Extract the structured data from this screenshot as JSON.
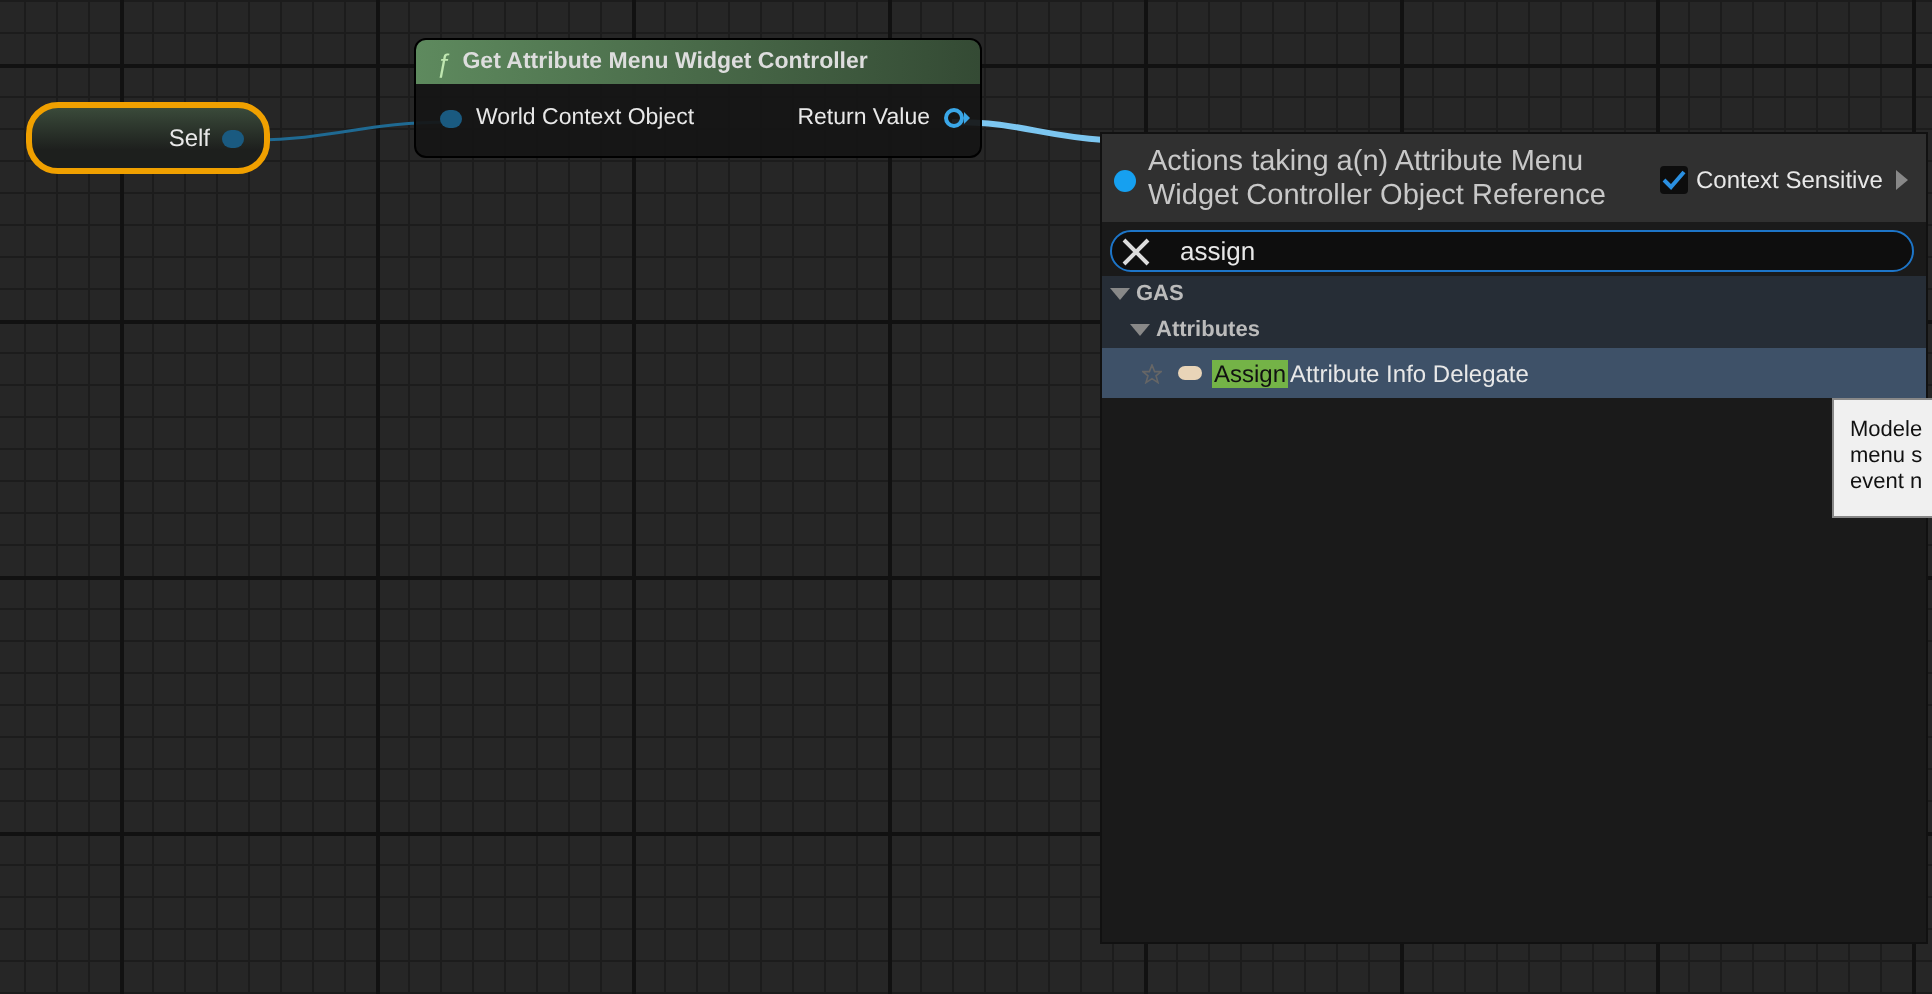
{
  "graph": {
    "self_node": {
      "label": "Self",
      "selected": true
    },
    "function_node": {
      "icon_text": "ƒ",
      "title": "Get Attribute Menu Widget Controller",
      "input_pin": "World Context Object",
      "output_pin": "Return Value"
    }
  },
  "action_menu": {
    "title": "Actions taking a(n) Attribute Menu Widget Controller Object Reference",
    "context_sensitive": {
      "label": "Context Sensitive",
      "checked": true
    },
    "search": {
      "value": "assign"
    },
    "tree": [
      {
        "label": "GAS",
        "expanded": true,
        "children": [
          {
            "label": "Attributes",
            "expanded": true,
            "children": [
              {
                "match": "Assign",
                "rest": "Attribute Info Delegate",
                "selected": true
              }
            ]
          }
        ]
      }
    ]
  },
  "tooltip": {
    "lines": [
      "Modele",
      "menu s",
      "event n"
    ]
  }
}
